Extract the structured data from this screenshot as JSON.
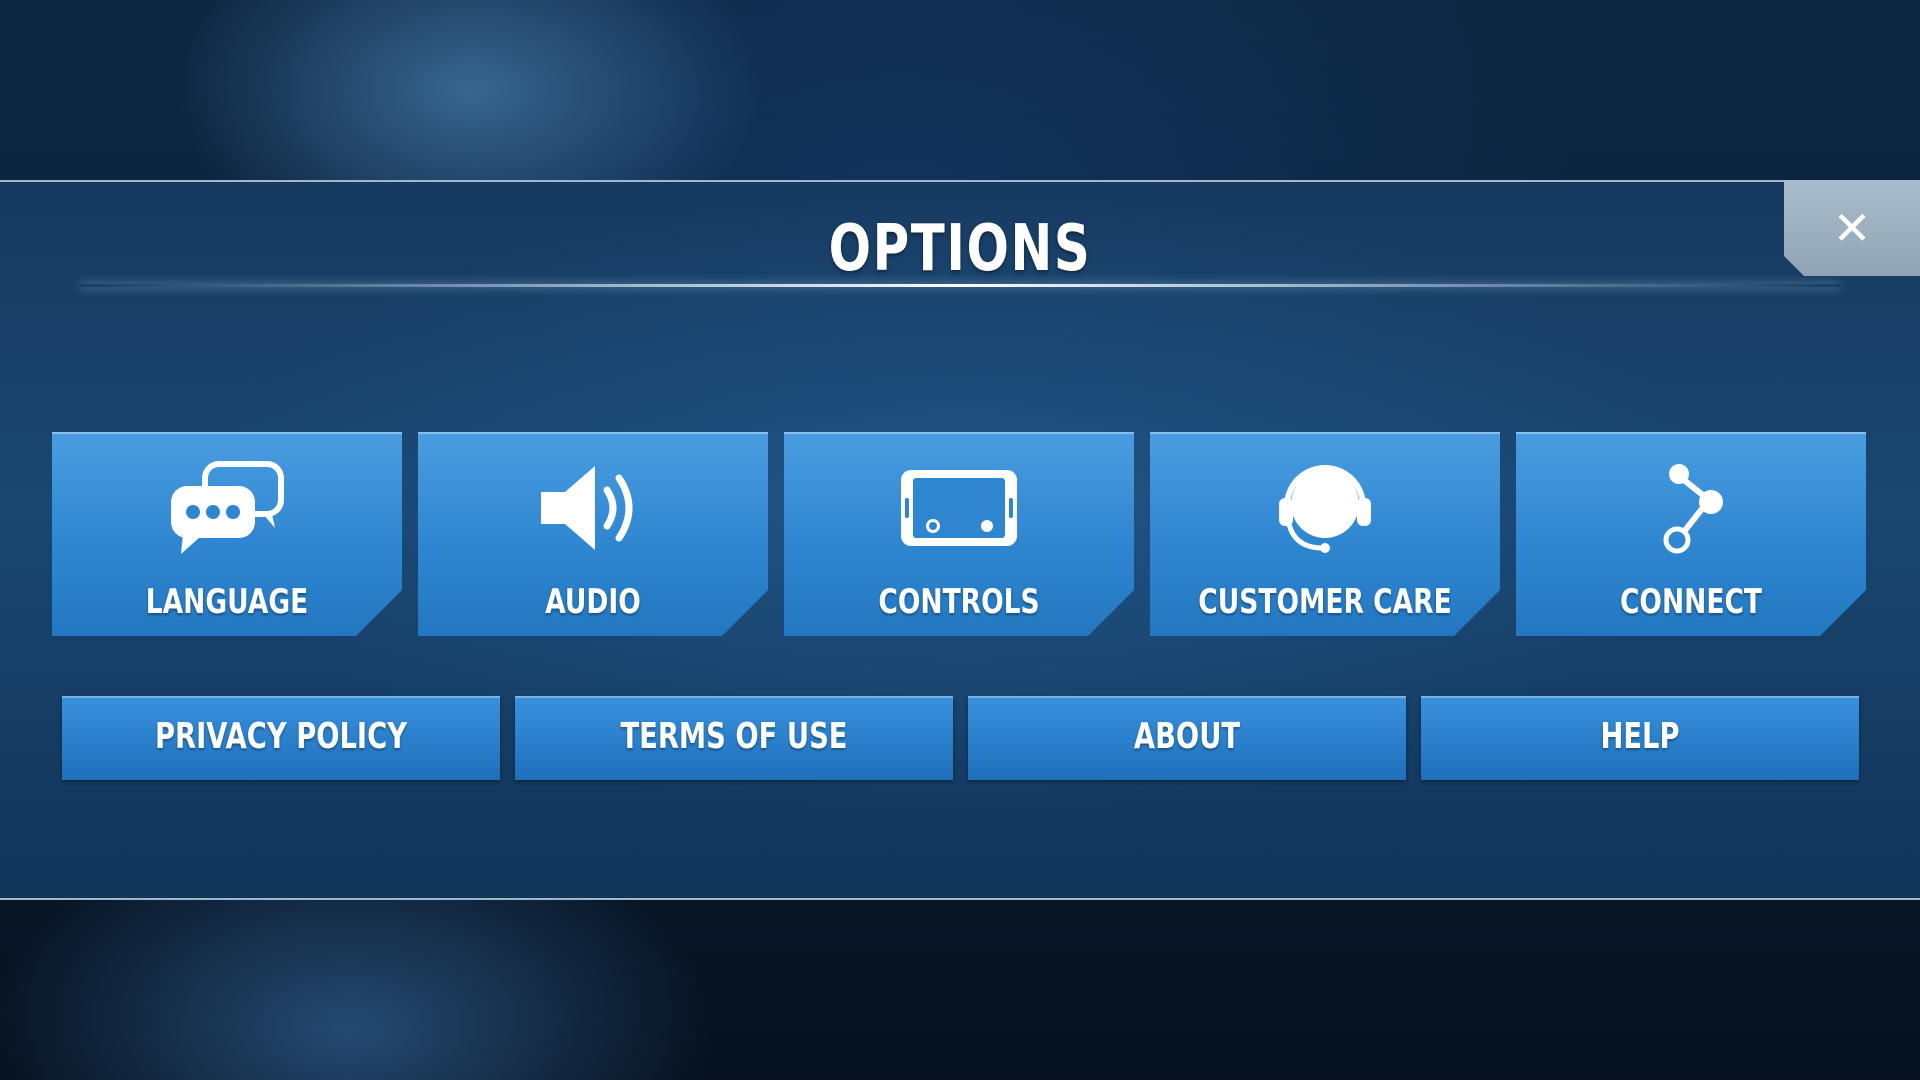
{
  "title": "OPTIONS",
  "close_label": "✕",
  "tiles": [
    {
      "label": "LANGUAGE",
      "icon": "chat-bubbles-icon"
    },
    {
      "label": "AUDIO",
      "icon": "speaker-icon"
    },
    {
      "label": "CONTROLS",
      "icon": "phone-landscape-icon"
    },
    {
      "label": "CUSTOMER CARE",
      "icon": "headset-icon"
    },
    {
      "label": "CONNECT",
      "icon": "share-icon"
    }
  ],
  "buttons": [
    {
      "label": "PRIVACY POLICY"
    },
    {
      "label": "TERMS OF USE"
    },
    {
      "label": "ABOUT"
    },
    {
      "label": "HELP"
    }
  ],
  "colors": {
    "tile_blue": "#2f86d0",
    "panel_blue": "#1a4670",
    "close_grey": "#9fb2c2"
  }
}
